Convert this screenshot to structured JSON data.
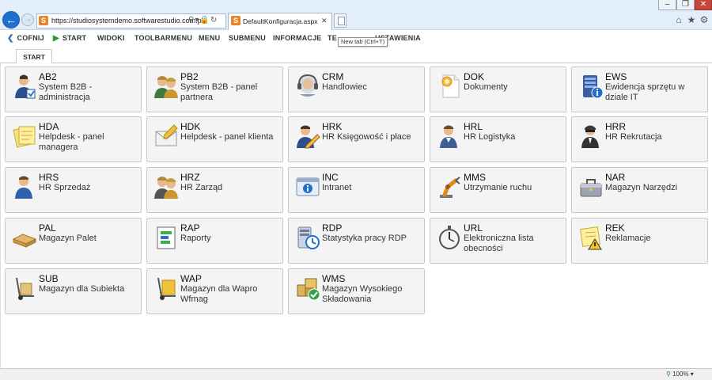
{
  "browser": {
    "address": "https://studiosystemdemo.softwarestudio.com.pl/",
    "tab_title": "DefaultKonfiguracja.aspx",
    "new_tab_tooltip": "New tab (Ctrl+T)",
    "zoom": "100%"
  },
  "toolbar": {
    "items": [
      {
        "label": "COFNIJ",
        "icon": "back-arrow-icon"
      },
      {
        "label": "START",
        "icon": "play-icon"
      },
      {
        "label": "WIDOKI"
      },
      {
        "label": "TOOLBARMENU"
      },
      {
        "label": "MENU"
      },
      {
        "label": "SUBMENU"
      },
      {
        "label": "INFORMACJE"
      },
      {
        "label": "TE"
      },
      {
        "label": "USTAWIENIA"
      }
    ]
  },
  "start_tab": "START",
  "tiles": [
    {
      "code": "AB2",
      "desc": "System B2B - administracja",
      "icon": "user-admin-icon"
    },
    {
      "code": "PB2",
      "desc": "System B2B - panel partnera",
      "icon": "users-partner-icon"
    },
    {
      "code": "CRM",
      "desc": "Handlowiec",
      "icon": "headset-icon"
    },
    {
      "code": "DOK",
      "desc": "Dokumenty",
      "icon": "document-icon"
    },
    {
      "code": "EWS",
      "desc": "Ewidencja sprzętu w dziale IT",
      "icon": "server-info-icon"
    },
    {
      "code": "HDA",
      "desc": "Helpdesk - panel managera",
      "icon": "notes-icon"
    },
    {
      "code": "HDK",
      "desc": "Helpdesk - panel klienta",
      "icon": "envelope-pen-icon"
    },
    {
      "code": "HRK",
      "desc": "HR Księgowość i płace",
      "icon": "user-pen-icon"
    },
    {
      "code": "HRL",
      "desc": "HR Logistyka",
      "icon": "user-logistics-icon"
    },
    {
      "code": "HRR",
      "desc": "HR Rekrutacja",
      "icon": "user-recruit-icon"
    },
    {
      "code": "HRS",
      "desc": "HR Sprzedaż",
      "icon": "user-sales-icon"
    },
    {
      "code": "HRZ",
      "desc": "HR Zarząd",
      "icon": "users-board-icon"
    },
    {
      "code": "INC",
      "desc": "Intranet",
      "icon": "info-window-icon"
    },
    {
      "code": "MMS",
      "desc": "Utrzymanie ruchu",
      "icon": "robot-arm-icon"
    },
    {
      "code": "NAR",
      "desc": "Magazyn Narzędzi",
      "icon": "toolbox-icon"
    },
    {
      "code": "PAL",
      "desc": "Magazyn Palet",
      "icon": "pallet-icon"
    },
    {
      "code": "RAP",
      "desc": "Raporty",
      "icon": "report-icon"
    },
    {
      "code": "RDP",
      "desc": "Statystyka pracy RDP",
      "icon": "server-clock-icon"
    },
    {
      "code": "URL",
      "desc": "Elektroniczna lista obecności",
      "icon": "stopwatch-icon"
    },
    {
      "code": "REK",
      "desc": "Reklamacje",
      "icon": "warning-note-icon"
    },
    {
      "code": "SUB",
      "desc": "Magazyn dla Subiekta",
      "icon": "hand-truck-icon"
    },
    {
      "code": "WAP",
      "desc": "Magazyn dla Wapro Wfmag",
      "icon": "hand-truck-box-icon"
    },
    {
      "code": "WMS",
      "desc": "Magazyn Wysokiego Składowania",
      "icon": "boxes-check-icon"
    }
  ]
}
